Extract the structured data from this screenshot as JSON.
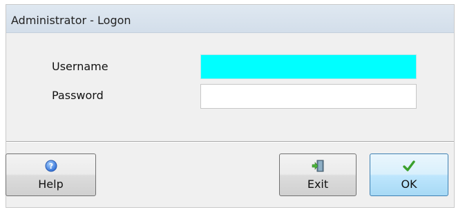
{
  "window": {
    "title": "Administrator - Logon"
  },
  "form": {
    "username_label": "Username",
    "username_value": "",
    "password_label": "Password",
    "password_value": ""
  },
  "buttons": {
    "help_label": "Help",
    "exit_label": "Exit",
    "ok_label": "OK"
  },
  "icons": {
    "help": "help-icon",
    "exit": "exit-door-icon",
    "ok": "checkmark-icon"
  },
  "colors": {
    "active_field": "#00ffff",
    "ok_check": "#3aa02b",
    "help_blue": "#3f7ee0"
  }
}
